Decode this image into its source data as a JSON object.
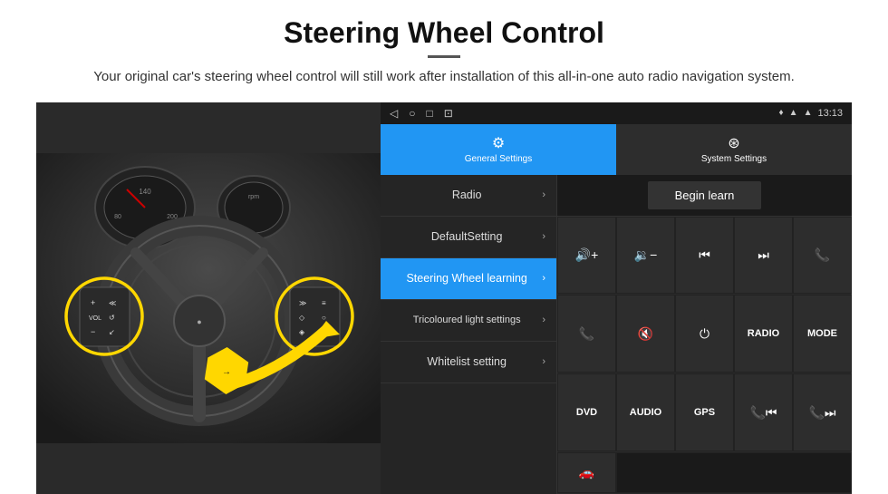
{
  "header": {
    "title": "Steering Wheel Control",
    "subtitle": "Your original car's steering wheel control will still work after installation of this all-in-one auto radio navigation system."
  },
  "status_bar": {
    "time": "13:13",
    "icons": {
      "back": "◁",
      "home": "○",
      "recent": "□",
      "screenshot": "⊡",
      "gps": "♦",
      "wifi": "▲",
      "signal": "▲"
    }
  },
  "tabs": [
    {
      "id": "general",
      "label": "General Settings",
      "active": true
    },
    {
      "id": "system",
      "label": "System Settings",
      "active": false
    }
  ],
  "menu_items": [
    {
      "id": "radio",
      "label": "Radio",
      "active": false
    },
    {
      "id": "default",
      "label": "DefaultSetting",
      "active": false
    },
    {
      "id": "steering",
      "label": "Steering Wheel learning",
      "active": true
    },
    {
      "id": "tricoloured",
      "label": "Tricoloured light settings",
      "active": false
    },
    {
      "id": "whitelist",
      "label": "Whitelist setting",
      "active": false
    }
  ],
  "begin_learn_label": "Begin learn",
  "button_grid": {
    "rows": [
      [
        {
          "id": "vol-up",
          "label": "🔊+",
          "type": "icon"
        },
        {
          "id": "vol-down",
          "label": "🔉-",
          "type": "icon"
        },
        {
          "id": "prev",
          "label": "⏮",
          "type": "icon"
        },
        {
          "id": "next",
          "label": "⏭",
          "type": "icon"
        },
        {
          "id": "phone",
          "label": "📞",
          "type": "icon"
        }
      ],
      [
        {
          "id": "hangup",
          "label": "📞✕",
          "type": "icon"
        },
        {
          "id": "mute",
          "label": "🔇",
          "type": "icon"
        },
        {
          "id": "power",
          "label": "⏻",
          "type": "icon"
        },
        {
          "id": "radio-btn",
          "label": "RADIO",
          "type": "text"
        },
        {
          "id": "mode",
          "label": "MODE",
          "type": "text"
        }
      ],
      [
        {
          "id": "dvd",
          "label": "DVD",
          "type": "text"
        },
        {
          "id": "audio",
          "label": "AUDIO",
          "type": "text"
        },
        {
          "id": "gps-btn",
          "label": "GPS",
          "type": "text"
        },
        {
          "id": "tel-prev",
          "label": "📞⏮",
          "type": "icon"
        },
        {
          "id": "tel-next",
          "label": "📞⏭",
          "type": "icon"
        }
      ],
      [
        {
          "id": "car",
          "label": "🚗",
          "type": "icon"
        }
      ]
    ]
  }
}
